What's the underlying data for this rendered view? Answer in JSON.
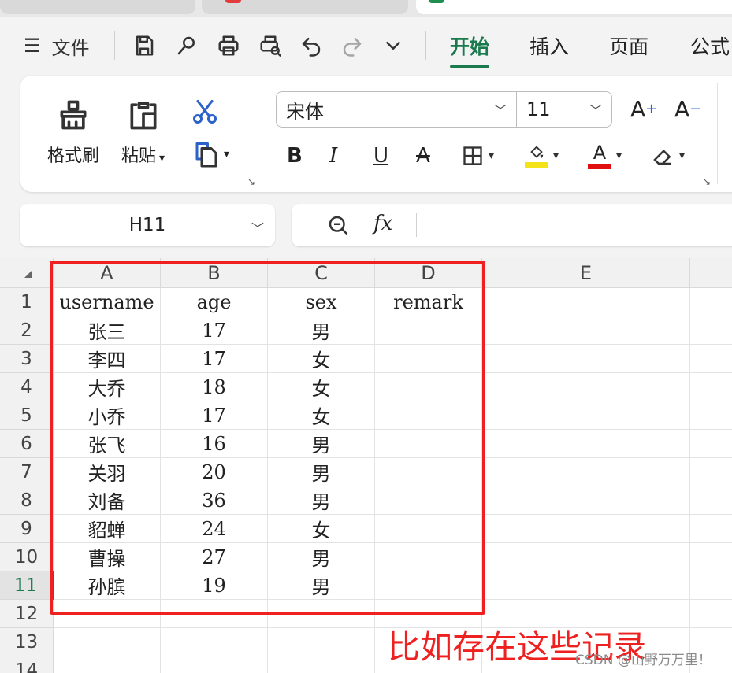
{
  "menu": {
    "file": "文件",
    "tabs": [
      "开始",
      "插入",
      "页面",
      "公式"
    ]
  },
  "ribbon": {
    "format_painter": "格式刷",
    "paste": "粘贴",
    "font_name": "宋体",
    "font_size": "11"
  },
  "namebox": {
    "value": "H11"
  },
  "sheet": {
    "columns": [
      "A",
      "B",
      "C",
      "D",
      "E"
    ],
    "rows": [
      "1",
      "2",
      "3",
      "4",
      "5",
      "6",
      "7",
      "8",
      "9",
      "10",
      "11",
      "12",
      "13",
      "14"
    ],
    "header": [
      "username",
      "age",
      "sex",
      "remark"
    ],
    "records": [
      [
        "张三",
        "17",
        "男",
        ""
      ],
      [
        "李四",
        "17",
        "女",
        ""
      ],
      [
        "大乔",
        "18",
        "女",
        ""
      ],
      [
        "小乔",
        "17",
        "女",
        ""
      ],
      [
        "张飞",
        "16",
        "男",
        ""
      ],
      [
        "关羽",
        "20",
        "男",
        ""
      ],
      [
        "刘备",
        "36",
        "男",
        ""
      ],
      [
        "貂蝉",
        "24",
        "女",
        ""
      ],
      [
        "曹操",
        "27",
        "男",
        ""
      ],
      [
        "孙膑",
        "19",
        "男",
        ""
      ]
    ],
    "selected_row": "11"
  },
  "annotation": "比如存在这些记录",
  "watermark": "CSDN @山野万万里！",
  "colors": {
    "accent": "#1a7a4e",
    "annotation": "#ee2020"
  }
}
